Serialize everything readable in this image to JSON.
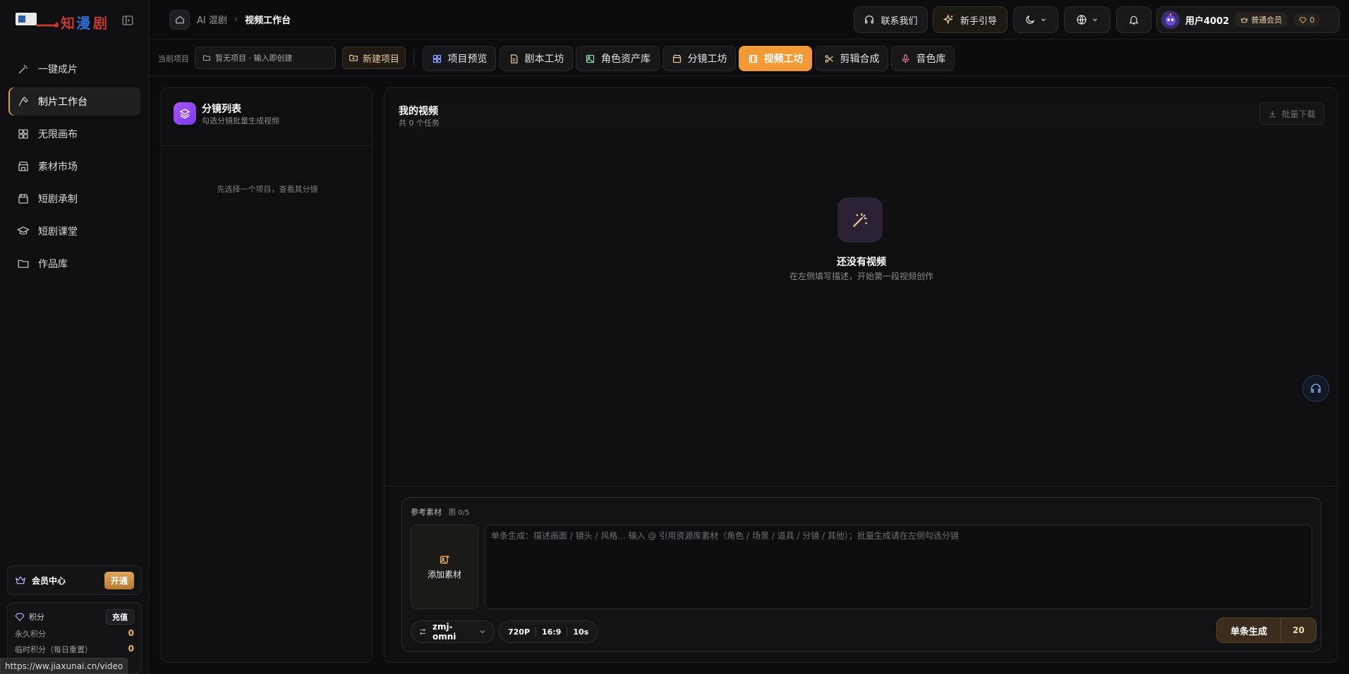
{
  "brand": {
    "logo_alt": "知漫剧"
  },
  "sidebar": {
    "items": [
      {
        "label": "一键成片",
        "icon": "magic-wand-icon"
      },
      {
        "label": "制片工作台",
        "icon": "hammer-icon",
        "active": true
      },
      {
        "label": "无限画布",
        "icon": "grid-icon"
      },
      {
        "label": "素材市场",
        "icon": "store-icon"
      },
      {
        "label": "短剧承制",
        "icon": "clapperboard-icon"
      },
      {
        "label": "短剧课堂",
        "icon": "graduation-cap-icon"
      },
      {
        "label": "作品库",
        "icon": "folder-icon"
      }
    ],
    "member": {
      "label": "会员中心",
      "button": "开通"
    },
    "points": {
      "label": "积分",
      "button": "充值",
      "rows": [
        {
          "label": "永久积分",
          "value": "0"
        },
        {
          "label": "临时积分（每日重置）",
          "value": "0"
        }
      ]
    }
  },
  "header": {
    "breadcrumb": {
      "parent": "AI 混剧",
      "current": "视频工作台"
    },
    "contact": "联系我们",
    "guide": "新手引导",
    "user": {
      "name": "用户4002",
      "tier": "普通会员",
      "points": "0"
    }
  },
  "subbar": {
    "current_project_label": "当前项目",
    "project_placeholder": "暂无项目 · 输入即创建",
    "new_project": "新建项目",
    "tabs": [
      {
        "label": "项目预览",
        "icon": "grid-icon",
        "color": "#8fa5ff"
      },
      {
        "label": "剧本工坊",
        "icon": "document-icon",
        "color": "#e8c99b"
      },
      {
        "label": "角色资产库",
        "icon": "image-icon",
        "color": "#7ee0b0"
      },
      {
        "label": "分镜工坊",
        "icon": "clapperboard-icon",
        "color": "#e8c99b"
      },
      {
        "label": "视频工坊",
        "icon": "film-icon",
        "color": "#ffffff",
        "active": true
      },
      {
        "label": "剪辑合成",
        "icon": "scissors-icon",
        "color": "#e8c99b"
      },
      {
        "label": "音色库",
        "icon": "mic-icon",
        "color": "#ff7a9a"
      }
    ]
  },
  "left_panel": {
    "title": "分镜列表",
    "subtitle": "勾选分镜批量生成视频",
    "empty": "先选择一个项目，查看其分镜"
  },
  "right_panel": {
    "title": "我的视频",
    "subtitle": "共 0 个任务",
    "batch_download": "批量下载",
    "empty_title": "还没有视频",
    "empty_sub": "在左侧填写描述，开始第一段视频创作"
  },
  "composer": {
    "ref_label": "参考素材",
    "ref_count": "图 0/5",
    "add_material": "添加素材",
    "placeholder": "单条生成：描述画面 / 镜头 / 风格... 输入 @ 引用资源库素材（角色 / 场景 / 道具 / 分镜 / 其他）；批量生成请在左侧勾选分镜",
    "model": "zmj-omni",
    "resolution": "720P",
    "ratio": "16:9",
    "duration": "10s",
    "generate": "单条生成",
    "cost": "20"
  },
  "status_url": "https://ww.jiaxunai.cn/video"
}
